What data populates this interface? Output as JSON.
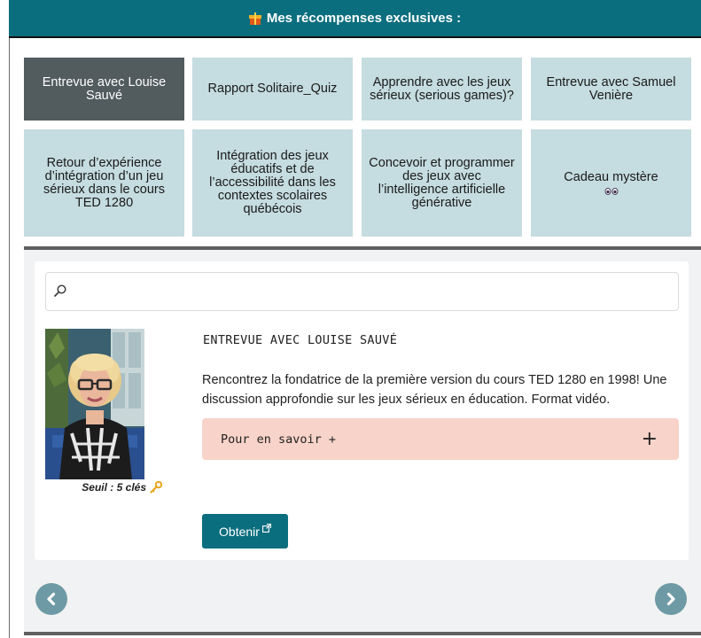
{
  "header": {
    "title": "Mes récompenses exclusives :",
    "icon": "gift-icon"
  },
  "rewards": [
    {
      "label": "Entrevue avec Louise Sauvé",
      "active": true
    },
    {
      "label": "Rapport Solitaire_Quiz",
      "active": false
    },
    {
      "label": "Apprendre avec les jeux sérieux (serious games)?",
      "active": false
    },
    {
      "label": "Entrevue avec Samuel Venière",
      "active": false
    },
    {
      "label": "Retour d’expérience d’intégration d’un jeu sérieux dans le cours TED 1280",
      "active": false
    },
    {
      "label": "Intégration des jeux éducatifs et de l’accessibilité dans les contextes scolaires québécois",
      "active": false
    },
    {
      "label": "Concevoir et programmer des jeux avec l’intelligence artificielle générative",
      "active": false
    },
    {
      "label": "Cadeau mystère",
      "active": false,
      "extra_icon": "eyes-icon"
    }
  ],
  "search": {
    "placeholder": "",
    "value": ""
  },
  "detail": {
    "title": "ENTREVUE AVEC LOUISE SAUVÉ",
    "threshold": "Seuil : 5 clés",
    "description": "Rencontrez la fondatrice de la première version du cours TED 1280 en 1998! Une discussion approfondie sur les jeux sérieux en éducation. Format vidéo.",
    "accordion_label": "Pour en savoir +",
    "accordion_icon": "+",
    "button_label": "Obtenir"
  },
  "colors": {
    "accent": "#0b6e7e",
    "tile": "#c5dce0",
    "tile_active": "#525b5e",
    "accordion": "#f8d3c9",
    "nav": "#6d9aa4"
  }
}
